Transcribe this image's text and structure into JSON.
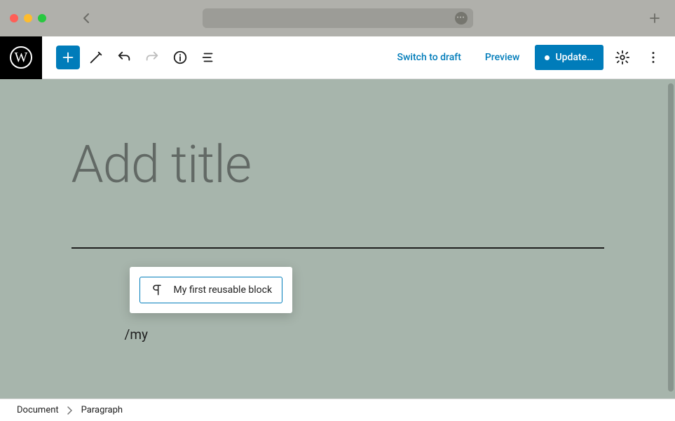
{
  "toolbar": {
    "switch_to_draft": "Switch to draft",
    "preview": "Preview",
    "publish": "Update…"
  },
  "editor": {
    "title_placeholder": "Add title",
    "typed_command": "/my"
  },
  "suggestion": {
    "label": "My first reusable block"
  },
  "breadcrumb": {
    "root": "Document",
    "current": "Paragraph"
  },
  "icons": {
    "wp_logo_letter": "W"
  }
}
